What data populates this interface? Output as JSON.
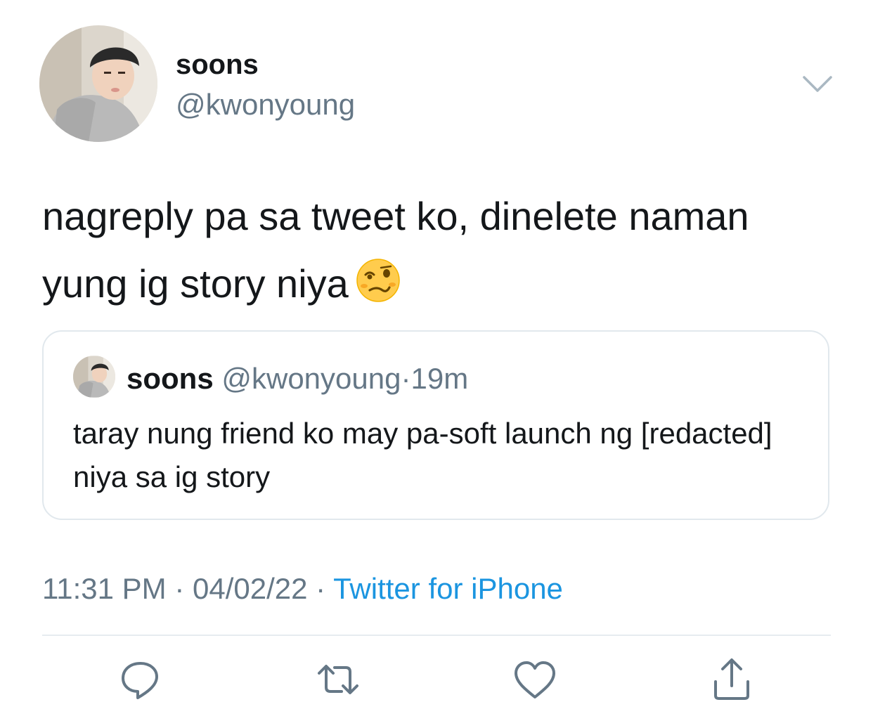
{
  "author": {
    "display_name": "soons",
    "handle": "@kwonyoung",
    "avatar_icon": "profile-photo"
  },
  "tweet": {
    "text": "nagreply pa sa tweet ko, dinelete naman yung ig story niya",
    "emoji_icon": "woozy-face-emoji"
  },
  "quote": {
    "display_name": "soons",
    "handle": "@kwonyoung",
    "separator": "·",
    "time": "19m",
    "text": "taray nung friend ko may pa-soft launch ng [redacted] niya sa ig story"
  },
  "meta": {
    "time": "11:31 PM",
    "separator1": "·",
    "date": "04/02/22",
    "separator2": "·",
    "source": "Twitter for iPhone"
  },
  "actions": {
    "icons": [
      "reply-icon",
      "retweet-icon",
      "like-icon",
      "share-icon"
    ]
  },
  "colors": {
    "text": "#14171a",
    "secondary": "#657786",
    "link": "#1b95e0",
    "border": "#e1e8ed"
  }
}
